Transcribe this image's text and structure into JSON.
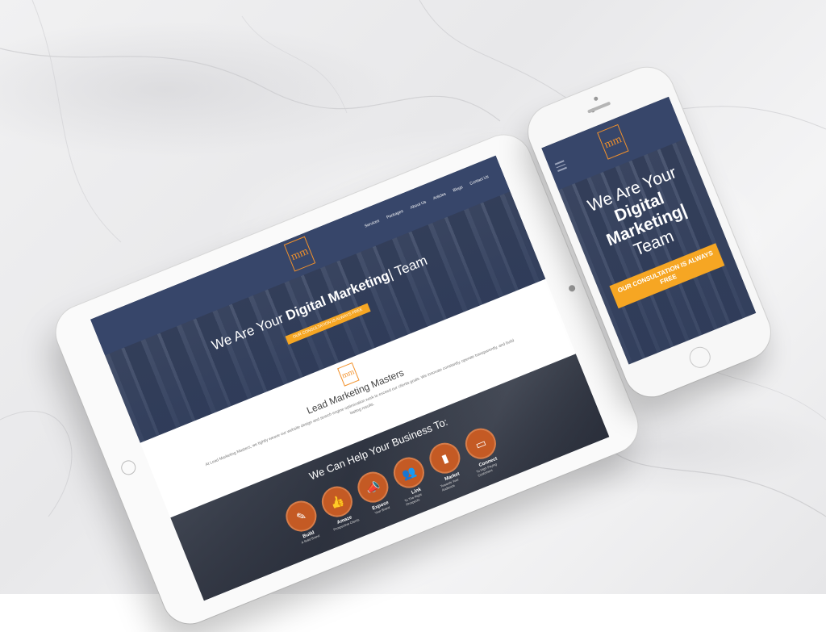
{
  "tablet": {
    "nav": [
      "Services",
      "Packages",
      "About Us",
      "Articles",
      "Blogs",
      "Contact Us"
    ],
    "logo_text": "mm",
    "hero": {
      "title_pre": "We Are Your ",
      "title_bold": "Digital Marketing",
      "title_post": "| Team",
      "cta": "OUR CONSULTATION IS ALWAYS FREE"
    },
    "about": {
      "logo_text": "mm",
      "title": "Lead Marketing Masters",
      "body": "At Lead Marketing Masters, we tightly weave our website design and search engine optimization work to exceed our clients goals. We innovate constantly, operate transparently, and build lasting results."
    },
    "services": {
      "title": "We Can Help Your Business To:",
      "items": [
        {
          "icon": "pencil-icon",
          "glyph": "✎",
          "label": "Build",
          "sub": "A Solid Brand"
        },
        {
          "icon": "thumbs-up-icon",
          "glyph": "👍",
          "label": "Amaze",
          "sub": "Prospective Clients"
        },
        {
          "icon": "megaphone-icon",
          "glyph": "📣",
          "label": "Expose",
          "sub": "Your Brand"
        },
        {
          "icon": "people-icon",
          "glyph": "👥",
          "label": "Link",
          "sub": "To The Right Prospects"
        },
        {
          "icon": "bar-chart-icon",
          "glyph": "▮",
          "label": "Market",
          "sub": "Towards Your Audience"
        },
        {
          "icon": "device-icon",
          "glyph": "▭",
          "label": "Connect",
          "sub": "To High Paying Customers"
        }
      ]
    }
  },
  "phone": {
    "logo_text": "mm",
    "hero": {
      "line1": "We Are Your",
      "line2": "Digital",
      "line3": "Marketing|",
      "line4": "Team",
      "cta": "OUR CONSULTATION IS ALWAYS FREE"
    }
  }
}
